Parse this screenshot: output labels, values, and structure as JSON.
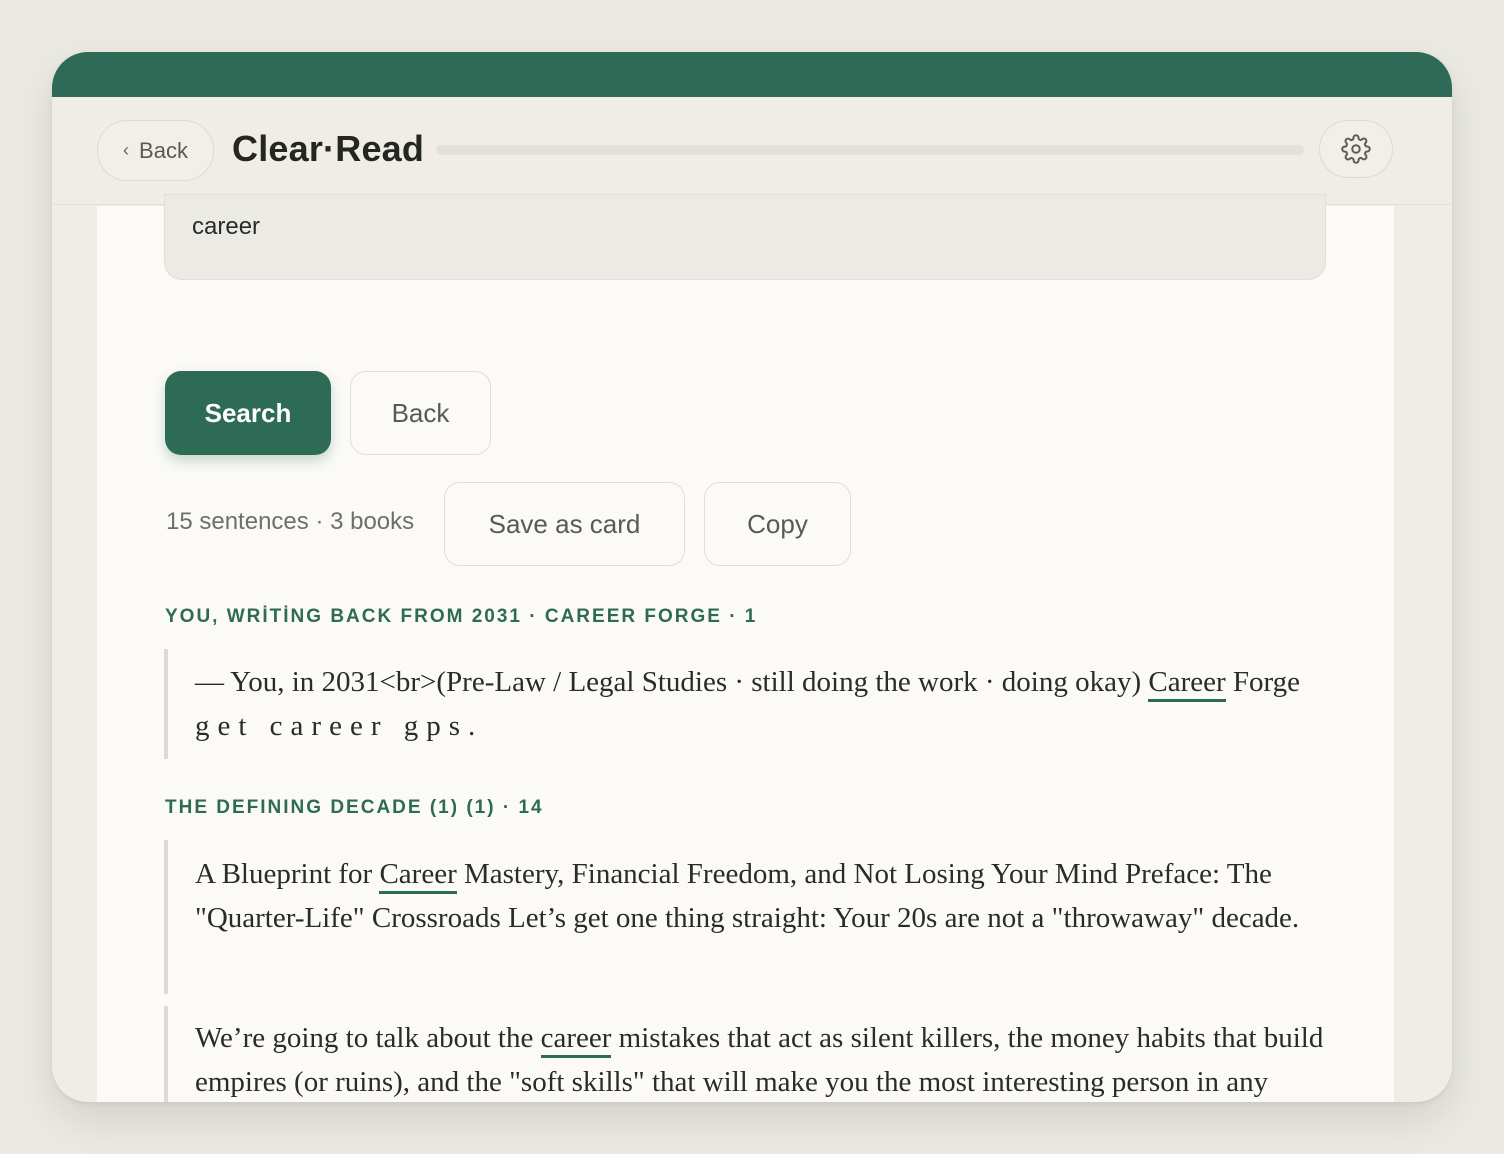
{
  "header": {
    "back_label": "Back",
    "title": "Clear·Read"
  },
  "search": {
    "value": "career"
  },
  "actions": {
    "search_label": "Search",
    "back_label": "Back",
    "save_label": "Save as card",
    "copy_label": "Copy"
  },
  "stats": "15 sentences · 3 books",
  "results": [
    {
      "source": "YOU, WRİTİNG BACK FROM 2031 · CAREER FORGE · 1",
      "quotes": [
        {
          "pre": "— You, in 2031<br>(Pre-Law / Legal Studies · still doing the work · doing okay) ",
          "highlight": "Career",
          "post": " Forge",
          "spaced": "get career gps."
        }
      ]
    },
    {
      "source": "THE DEFINING DECADE (1) (1) · 14",
      "quotes": [
        {
          "pre": "A Blueprint for ",
          "highlight": "Career",
          "post": " Mastery, Financial Freedom, and Not Losing Your Mind Preface: The \"Quarter-Life\" Crossroads Let’s get one thing straight: Your 20s are not a \"throwaway\" decade."
        },
        {
          "pre": "We’re going to talk about the ",
          "highlight": "career",
          "post": " mistakes that act as silent killers, the money habits that build empires (or ruins), and the \"soft skills\" that will make you the most interesting person in any room."
        }
      ]
    }
  ],
  "icons": {
    "back": "chevron-left-icon",
    "settings": "gear-icon"
  },
  "colors": {
    "accent": "#2e6b57",
    "background": "#efede5",
    "panel": "#fbfaf6"
  }
}
